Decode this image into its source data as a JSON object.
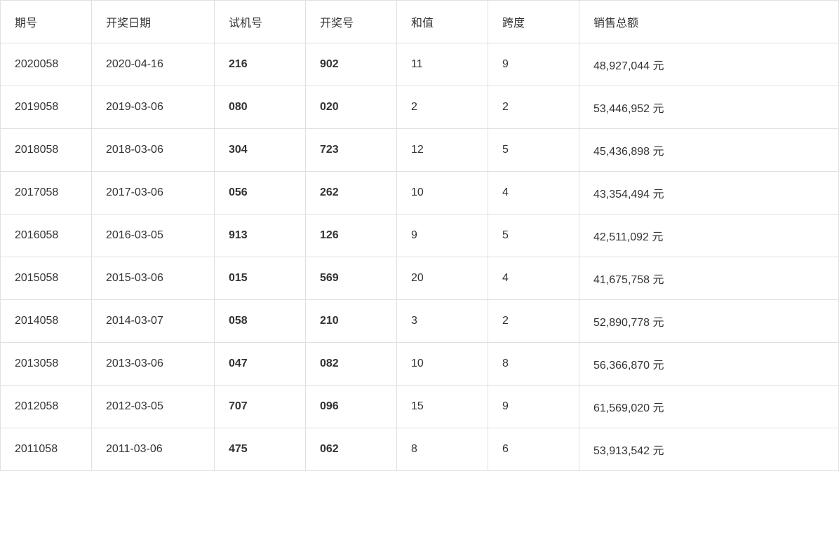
{
  "table": {
    "headers": [
      "期号",
      "开奖日期",
      "试机号",
      "开奖号",
      "和值",
      "跨度",
      "销售总额"
    ],
    "rows": [
      {
        "qihao": "2020058",
        "date": "2020-04-16",
        "shiji": "216",
        "kaijang": "902",
        "hezhi": "11",
        "kuadu": "9",
        "xiaoshou": "48,927,044 元"
      },
      {
        "qihao": "2019058",
        "date": "2019-03-06",
        "shiji": "080",
        "kaijang": "020",
        "hezhi": "2",
        "kuadu": "2",
        "xiaoshou": "53,446,952 元"
      },
      {
        "qihao": "2018058",
        "date": "2018-03-06",
        "shiji": "304",
        "kaijang": "723",
        "hezhi": "12",
        "kuadu": "5",
        "xiaoshou": "45,436,898 元"
      },
      {
        "qihao": "2017058",
        "date": "2017-03-06",
        "shiji": "056",
        "kaijang": "262",
        "hezhi": "10",
        "kuadu": "4",
        "xiaoshou": "43,354,494 元"
      },
      {
        "qihao": "2016058",
        "date": "2016-03-05",
        "shiji": "913",
        "kaijang": "126",
        "hezhi": "9",
        "kuadu": "5",
        "xiaoshou": "42,511,092 元"
      },
      {
        "qihao": "2015058",
        "date": "2015-03-06",
        "shiji": "015",
        "kaijang": "569",
        "hezhi": "20",
        "kuadu": "4",
        "xiaoshou": "41,675,758 元"
      },
      {
        "qihao": "2014058",
        "date": "2014-03-07",
        "shiji": "058",
        "kaijang": "210",
        "hezhi": "3",
        "kuadu": "2",
        "xiaoshou": "52,890,778 元"
      },
      {
        "qihao": "2013058",
        "date": "2013-03-06",
        "shiji": "047",
        "kaijang": "082",
        "hezhi": "10",
        "kuadu": "8",
        "xiaoshou": "56,366,870 元"
      },
      {
        "qihao": "2012058",
        "date": "2012-03-05",
        "shiji": "707",
        "kaijang": "096",
        "hezhi": "15",
        "kuadu": "9",
        "xiaoshou": "61,569,020 元"
      },
      {
        "qihao": "2011058",
        "date": "2011-03-06",
        "shiji": "475",
        "kaijang": "062",
        "hezhi": "8",
        "kuadu": "6",
        "xiaoshou": "53,913,542 元"
      }
    ]
  }
}
